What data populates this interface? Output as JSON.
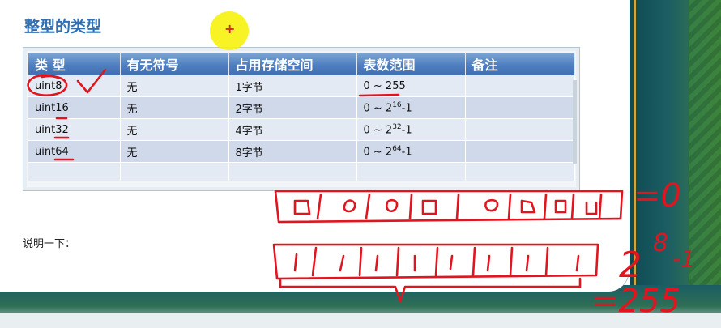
{
  "slide": {
    "title": "整型的类型",
    "caption": "说明一下："
  },
  "table": {
    "headers": [
      "类 型",
      "有无符号",
      "占用存储空间",
      "表数范围",
      "备注"
    ],
    "rows": [
      {
        "type": "uint8",
        "signed": "无",
        "storage": "1字节",
        "range_base": "0 ~ 255",
        "range_exp": "",
        "range_tail": "",
        "note": ""
      },
      {
        "type": "uint16",
        "signed": "无",
        "storage": "2字节",
        "range_base": "0 ~ 2",
        "range_exp": "16",
        "range_tail": "-1",
        "note": ""
      },
      {
        "type": "uint32",
        "signed": "无",
        "storage": "4字节",
        "range_base": "0 ~ 2",
        "range_exp": "32",
        "range_tail": "-1",
        "note": ""
      },
      {
        "type": "uint64",
        "signed": "无",
        "storage": "8字节",
        "range_base": "0 ~ 2",
        "range_exp": "64",
        "range_tail": "-1",
        "note": ""
      }
    ]
  },
  "annotations": {
    "eq_zero": "=0",
    "eq_two": "2",
    "eq_eight": "8",
    "eq_minus_one": "-1",
    "eq_255": "=255",
    "pen_color": "#e0151f"
  },
  "colors": {
    "title": "#2f6fb3",
    "header_bg": "#4f7fc0",
    "row_light": "#e4eaf3",
    "row_dark": "#cfd9ea",
    "highlight": "#f6f20c"
  }
}
